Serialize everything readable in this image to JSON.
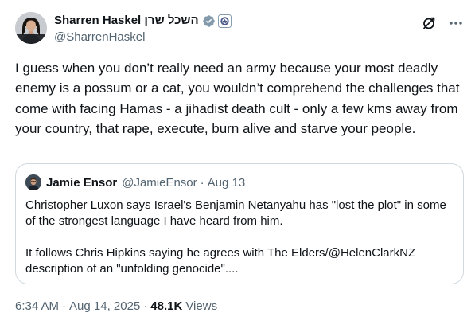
{
  "tweet": {
    "display_name": "Sharren Haskel השכל שרן",
    "handle": "@SharrenHaskel",
    "text": "I guess when you don’t really need an army because your most deadly enemy is a possum or a cat, you wouldn’t comprehend the challenges that come with facing Hamas - a jihadist death cult - only a few kms away from your country, that rape, execute, burn alive and starve your people.",
    "time": "6:34 AM",
    "separator": "·",
    "date": "Aug 14, 2025",
    "views_count": "48.1K",
    "views_label": "Views"
  },
  "quoted": {
    "display_name": "Jamie Ensor",
    "handle": "@JamieEnsor",
    "separator": "·",
    "date": "Aug 13",
    "paragraph1": "Christopher Luxon says Israel's Benjamin Netanyahu has \"lost the plot\" in some of the strongest language I have heard from him.",
    "paragraph2": "It follows Chris Hipkins saying he agrees with The Elders/@HelenClarkNZ description of an \"unfolding genocide\"...."
  },
  "icons": {
    "verified": "verified-badge-icon",
    "affiliate": "affiliate-badge-icon",
    "grok": "grok-icon",
    "more": "more-icon"
  },
  "colors": {
    "text": "#0f1419",
    "secondary": "#536471",
    "border": "#cfd9de",
    "verified_badge": "#829aab"
  }
}
